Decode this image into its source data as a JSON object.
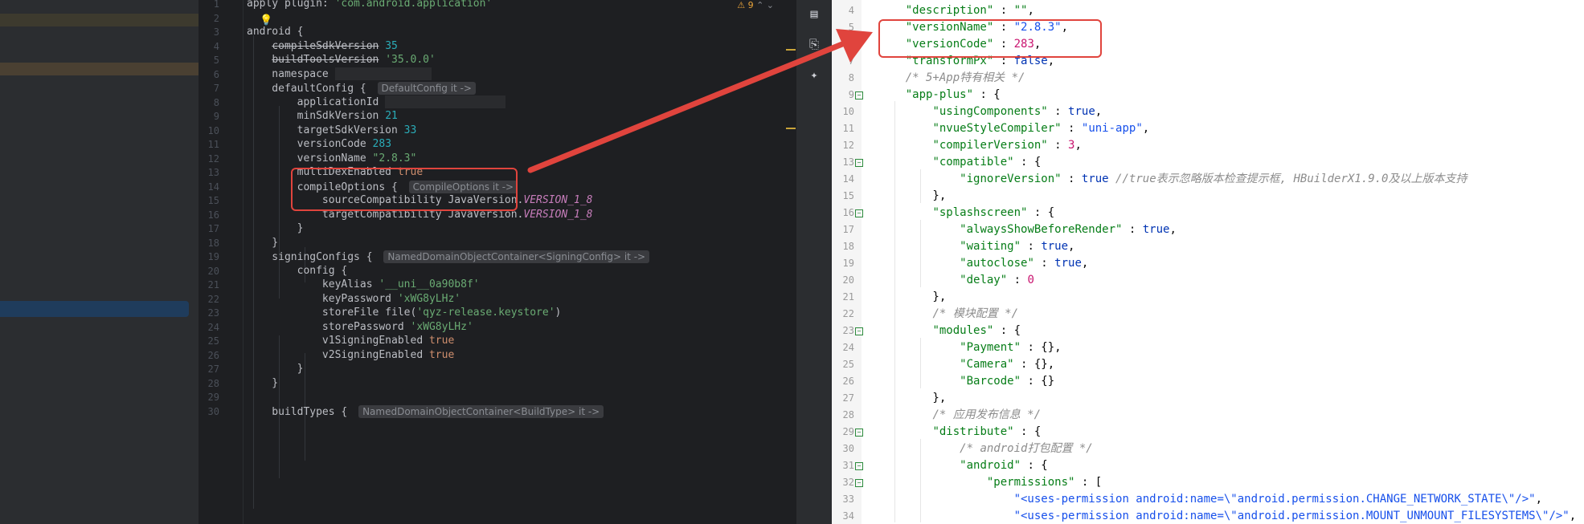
{
  "left_editor": {
    "lines": [
      {
        "n": "1",
        "segs": [
          [
            "apply plugin: ",
            ""
          ],
          [
            "'com.android.application'",
            "str"
          ]
        ]
      },
      {
        "n": "2",
        "segs": []
      },
      {
        "n": "3",
        "segs": [
          [
            "android {",
            ""
          ]
        ]
      },
      {
        "n": "4",
        "segs": [
          [
            "    ",
            ""
          ],
          [
            "compileSdkVersion",
            "strike"
          ],
          [
            " ",
            ""
          ],
          [
            "35",
            "num"
          ]
        ]
      },
      {
        "n": "5",
        "segs": [
          [
            "    ",
            ""
          ],
          [
            "buildToolsVersion",
            "strike"
          ],
          [
            " ",
            ""
          ],
          [
            "'35.0.0'",
            "str"
          ]
        ]
      },
      {
        "n": "6",
        "segs": [
          [
            "    namespace ",
            ""
          ],
          [
            "MASK120",
            "mask"
          ]
        ]
      },
      {
        "n": "7",
        "segs": [
          [
            "    defaultConfig { ",
            ""
          ],
          [
            "DefaultConfig it ->",
            "hint"
          ]
        ]
      },
      {
        "n": "8",
        "segs": [
          [
            "        applicationId ",
            ""
          ],
          [
            "MASK150",
            "mask"
          ]
        ]
      },
      {
        "n": "9",
        "segs": [
          [
            "        minSdkVersion ",
            ""
          ],
          [
            "21",
            "num"
          ]
        ]
      },
      {
        "n": "10",
        "segs": [
          [
            "        targetSdkVersion ",
            ""
          ],
          [
            "33",
            "num"
          ]
        ]
      },
      {
        "n": "11",
        "segs": [
          [
            "        versionCode ",
            ""
          ],
          [
            "283",
            "num"
          ]
        ]
      },
      {
        "n": "12",
        "segs": [
          [
            "        versionName ",
            ""
          ],
          [
            "\"2.8.3\"",
            "str"
          ]
        ]
      },
      {
        "n": "13",
        "segs": [
          [
            "        multiDexEnabled ",
            ""
          ],
          [
            "true",
            "kw"
          ]
        ]
      },
      {
        "n": "14",
        "segs": [
          [
            "        compileOptions { ",
            ""
          ],
          [
            "CompileOptions it ->",
            "hint"
          ]
        ]
      },
      {
        "n": "15",
        "segs": [
          [
            "            sourceCompatibility JavaVersion.",
            ""
          ],
          [
            "VERSION_1_8",
            "fld"
          ]
        ]
      },
      {
        "n": "16",
        "segs": [
          [
            "            targetCompatibility JavaVersion.",
            ""
          ],
          [
            "VERSION_1_8",
            "fld"
          ]
        ]
      },
      {
        "n": "17",
        "segs": [
          [
            "        }",
            ""
          ]
        ]
      },
      {
        "n": "18",
        "segs": [
          [
            "    }",
            ""
          ]
        ]
      },
      {
        "n": "19",
        "segs": [
          [
            "    signingConfigs { ",
            ""
          ],
          [
            "NamedDomainObjectContainer<SigningConfig> it ->",
            "hint"
          ]
        ]
      },
      {
        "n": "20",
        "segs": [
          [
            "        config {",
            ""
          ]
        ]
      },
      {
        "n": "21",
        "segs": [
          [
            "            keyAlias ",
            ""
          ],
          [
            "'__uni__0a90b8f'",
            "str"
          ]
        ]
      },
      {
        "n": "22",
        "segs": [
          [
            "            keyPassword ",
            ""
          ],
          [
            "'xWG8yLHz'",
            "str"
          ]
        ]
      },
      {
        "n": "23",
        "segs": [
          [
            "            storeFile file(",
            ""
          ],
          [
            "'qyz-release.keystore'",
            "str"
          ],
          [
            ")",
            ""
          ]
        ]
      },
      {
        "n": "24",
        "segs": [
          [
            "            storePassword ",
            ""
          ],
          [
            "'xWG8yLHz'",
            "str"
          ]
        ]
      },
      {
        "n": "25",
        "segs": [
          [
            "            v1SigningEnabled ",
            ""
          ],
          [
            "true",
            "kw"
          ]
        ]
      },
      {
        "n": "26",
        "segs": [
          [
            "            v2SigningEnabled ",
            ""
          ],
          [
            "true",
            "kw"
          ]
        ]
      },
      {
        "n": "27",
        "segs": [
          [
            "        }",
            ""
          ]
        ]
      },
      {
        "n": "28",
        "segs": [
          [
            "    }",
            ""
          ]
        ]
      },
      {
        "n": "29",
        "segs": []
      },
      {
        "n": "30",
        "segs": [
          [
            "    buildTypes { ",
            ""
          ],
          [
            "NamedDomainObjectContainer<BuildType> it ->",
            "hint"
          ]
        ]
      }
    ],
    "warning_count": "9"
  },
  "right_editor": {
    "lines": [
      {
        "n": "4",
        "f": "",
        "segs": [
          [
            "    ",
            ""
          ],
          [
            "\"description\"",
            "key"
          ],
          [
            " : ",
            ""
          ],
          [
            "\"\"",
            "s"
          ],
          [
            ",",
            ""
          ]
        ]
      },
      {
        "n": "5",
        "f": "",
        "segs": [
          [
            "    ",
            ""
          ],
          [
            "\"versionName\"",
            "key"
          ],
          [
            " : ",
            ""
          ],
          [
            "\"2.8.3\"",
            "n"
          ],
          [
            ",",
            ""
          ]
        ]
      },
      {
        "n": "6",
        "f": "",
        "segs": [
          [
            "    ",
            ""
          ],
          [
            "\"versionCode\"",
            "key"
          ],
          [
            " : ",
            ""
          ],
          [
            "283",
            "v"
          ],
          [
            ",",
            ""
          ]
        ]
      },
      {
        "n": "7",
        "f": "",
        "segs": [
          [
            "    ",
            ""
          ],
          [
            "\"transformPx\"",
            "key"
          ],
          [
            " : ",
            ""
          ],
          [
            "false",
            "b"
          ],
          [
            ",",
            ""
          ]
        ]
      },
      {
        "n": "8",
        "f": "",
        "segs": [
          [
            "    ",
            ""
          ],
          [
            "/* 5+App特有相关 */",
            "c"
          ]
        ]
      },
      {
        "n": "9",
        "f": "−",
        "segs": [
          [
            "    ",
            ""
          ],
          [
            "\"app-plus\"",
            "key"
          ],
          [
            " : {",
            ""
          ]
        ]
      },
      {
        "n": "10",
        "f": "",
        "segs": [
          [
            "        ",
            ""
          ],
          [
            "\"usingComponents\"",
            "key"
          ],
          [
            " : ",
            ""
          ],
          [
            "true",
            "b"
          ],
          [
            ",",
            ""
          ]
        ]
      },
      {
        "n": "11",
        "f": "",
        "segs": [
          [
            "        ",
            ""
          ],
          [
            "\"nvueStyleCompiler\"",
            "key"
          ],
          [
            " : ",
            ""
          ],
          [
            "\"uni-app\"",
            "n"
          ],
          [
            ",",
            ""
          ]
        ]
      },
      {
        "n": "12",
        "f": "",
        "segs": [
          [
            "        ",
            ""
          ],
          [
            "\"compilerVersion\"",
            "key"
          ],
          [
            " : ",
            ""
          ],
          [
            "3",
            "v"
          ],
          [
            ",",
            ""
          ]
        ]
      },
      {
        "n": "13",
        "f": "−",
        "segs": [
          [
            "        ",
            ""
          ],
          [
            "\"compatible\"",
            "key"
          ],
          [
            " : {",
            ""
          ]
        ]
      },
      {
        "n": "14",
        "f": "",
        "segs": [
          [
            "            ",
            ""
          ],
          [
            "\"ignoreVersion\"",
            "key"
          ],
          [
            " : ",
            ""
          ],
          [
            "true",
            "b"
          ],
          [
            " ",
            ""
          ],
          [
            "//true表示忽略版本检查提示框, HBuilderX1.9.0及以上版本支持",
            "c"
          ]
        ]
      },
      {
        "n": "15",
        "f": "",
        "segs": [
          [
            "        },",
            ""
          ]
        ]
      },
      {
        "n": "16",
        "f": "−",
        "segs": [
          [
            "        ",
            ""
          ],
          [
            "\"splashscreen\"",
            "key"
          ],
          [
            " : {",
            ""
          ]
        ]
      },
      {
        "n": "17",
        "f": "",
        "segs": [
          [
            "            ",
            ""
          ],
          [
            "\"alwaysShowBeforeRender\"",
            "key"
          ],
          [
            " : ",
            ""
          ],
          [
            "true",
            "b"
          ],
          [
            ",",
            ""
          ]
        ]
      },
      {
        "n": "18",
        "f": "",
        "segs": [
          [
            "            ",
            ""
          ],
          [
            "\"waiting\"",
            "key"
          ],
          [
            " : ",
            ""
          ],
          [
            "true",
            "b"
          ],
          [
            ",",
            ""
          ]
        ]
      },
      {
        "n": "19",
        "f": "",
        "segs": [
          [
            "            ",
            ""
          ],
          [
            "\"autoclose\"",
            "key"
          ],
          [
            " : ",
            ""
          ],
          [
            "true",
            "b"
          ],
          [
            ",",
            ""
          ]
        ]
      },
      {
        "n": "20",
        "f": "",
        "segs": [
          [
            "            ",
            ""
          ],
          [
            "\"delay\"",
            "key"
          ],
          [
            " : ",
            ""
          ],
          [
            "0",
            "v"
          ]
        ]
      },
      {
        "n": "21",
        "f": "",
        "segs": [
          [
            "        },",
            ""
          ]
        ]
      },
      {
        "n": "22",
        "f": "",
        "segs": [
          [
            "        ",
            ""
          ],
          [
            "/* 模块配置 */",
            "c"
          ]
        ]
      },
      {
        "n": "23",
        "f": "−",
        "segs": [
          [
            "        ",
            ""
          ],
          [
            "\"modules\"",
            "key"
          ],
          [
            " : {",
            ""
          ]
        ]
      },
      {
        "n": "24",
        "f": "",
        "segs": [
          [
            "            ",
            ""
          ],
          [
            "\"Payment\"",
            "key"
          ],
          [
            " : {},",
            ""
          ]
        ]
      },
      {
        "n": "25",
        "f": "",
        "segs": [
          [
            "            ",
            ""
          ],
          [
            "\"Camera\"",
            "key"
          ],
          [
            " : {},",
            ""
          ]
        ]
      },
      {
        "n": "26",
        "f": "",
        "segs": [
          [
            "            ",
            ""
          ],
          [
            "\"Barcode\"",
            "key"
          ],
          [
            " : {}",
            ""
          ]
        ]
      },
      {
        "n": "27",
        "f": "",
        "segs": [
          [
            "        },",
            ""
          ]
        ]
      },
      {
        "n": "28",
        "f": "",
        "segs": [
          [
            "        ",
            ""
          ],
          [
            "/* 应用发布信息 */",
            "c"
          ]
        ]
      },
      {
        "n": "29",
        "f": "−",
        "segs": [
          [
            "        ",
            ""
          ],
          [
            "\"distribute\"",
            "key"
          ],
          [
            " : {",
            ""
          ]
        ]
      },
      {
        "n": "30",
        "f": "",
        "segs": [
          [
            "            ",
            ""
          ],
          [
            "/* android打包配置 */",
            "c"
          ]
        ]
      },
      {
        "n": "31",
        "f": "−",
        "segs": [
          [
            "            ",
            ""
          ],
          [
            "\"android\"",
            "key"
          ],
          [
            " : {",
            ""
          ]
        ]
      },
      {
        "n": "32",
        "f": "−",
        "segs": [
          [
            "                ",
            ""
          ],
          [
            "\"permissions\"",
            "key"
          ],
          [
            " : [",
            ""
          ]
        ]
      },
      {
        "n": "33",
        "f": "",
        "segs": [
          [
            "                    ",
            ""
          ],
          [
            "\"<uses-permission android:name=\\\"android.permission.CHANGE_NETWORK_STATE\\\"/>\"",
            "n"
          ],
          [
            ",",
            ""
          ]
        ]
      },
      {
        "n": "34",
        "f": "",
        "segs": [
          [
            "                    ",
            ""
          ],
          [
            "\"<uses-permission android:name=\\\"android.permission.MOUNT_UNMOUNT_FILESYSTEMS\\\"/>\"",
            "n"
          ],
          [
            ",",
            ""
          ]
        ]
      }
    ]
  },
  "colors": {
    "annotation_red": "#e0443d"
  }
}
